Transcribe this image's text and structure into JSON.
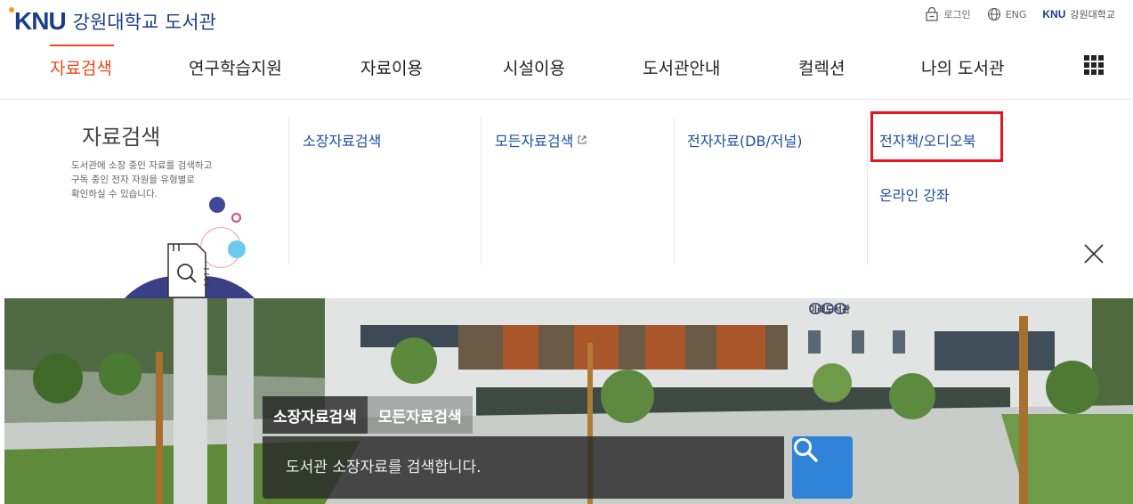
{
  "brand": {
    "mark": "KNU",
    "name": "강원대학교 도서관"
  },
  "util": {
    "login": "로그인",
    "eng": "ENG",
    "univ_mark": "KNU",
    "univ_name": "강원대학교"
  },
  "gnb": {
    "items": [
      {
        "label": "자료검색",
        "active": true
      },
      {
        "label": "연구학습지원"
      },
      {
        "label": "자료이용"
      },
      {
        "label": "시설이용"
      },
      {
        "label": "도서관안내"
      },
      {
        "label": "컬렉션"
      },
      {
        "label": "나의 도서관"
      }
    ]
  },
  "panel": {
    "title": "자료검색",
    "desc_line1": "도서관에 소장 중인 자료를 검색하고",
    "desc_line2": "구독 중인 전자 자원을 유형별로",
    "desc_line3": "확인하실 수 있습니다.",
    "links": [
      {
        "label": "소장자료검색"
      },
      {
        "label": "모든자료검색"
      },
      {
        "label": "전자자료(DB/저널)"
      },
      {
        "label": "전자책/오디오북"
      },
      {
        "label": "온라인 강좌"
      }
    ]
  },
  "hero": {
    "sign": "미래도서관",
    "tabs": [
      "소장자료검색",
      "모든자료검색"
    ],
    "search_placeholder": "도서관 소장자료를 검색합니다."
  },
  "colors": {
    "brand_blue": "#1a3e8c",
    "accent_orange": "#e8491b",
    "link_blue": "#1f4e9c",
    "highlight_red": "#e8141b",
    "search_button": "#2f83d8"
  }
}
